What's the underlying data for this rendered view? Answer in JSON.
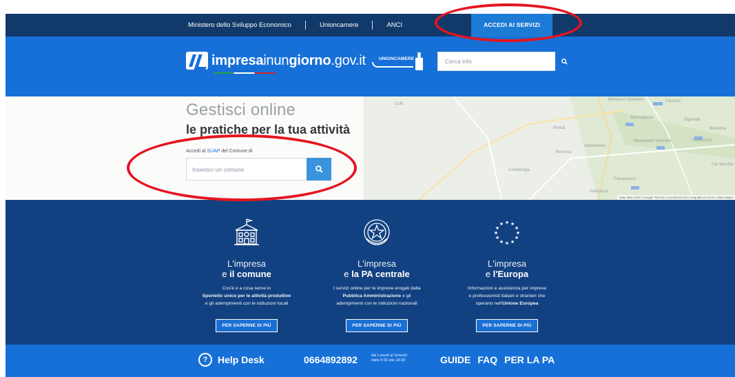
{
  "topbar": {
    "links": [
      "Ministero dello Sviluppo Economico",
      "Unioncamere",
      "ANCI"
    ],
    "cta": "ACCEDI AI SERVIZI"
  },
  "header": {
    "logo_bold1": "impresa",
    "logo_light1": "inun",
    "logo_bold2": "giorno",
    "logo_light2": ".gov.it",
    "partner_logo": "UNIONCAMERE",
    "search_placeholder": "Cerca info"
  },
  "hero": {
    "title_line1": "Gestisci online",
    "title_line2": "le pratiche per la tua attività",
    "label_prefix": "Accedi al ",
    "label_link": "SUAP",
    "label_suffix": " del Comune di",
    "search_placeholder": "Inserisci un comune",
    "map_copyright": "Map data ©2017 Google   Termini e condizioni d'uso   Segnala un errore nella mappa",
    "map_places": [
      "Montorso Vicentino",
      "Paulona",
      "Zermeghedo",
      "Signaldo",
      "Brendola",
      "Pedocchio",
      "Montebello Vicentino",
      "Gambellara",
      "Roncà",
      "Sarmazza",
      "Fracanzana",
      "Cal Vecchia",
      "Colli",
      "Costalunga",
      "Terrossa"
    ]
  },
  "services": [
    {
      "icon": "town-hall-icon",
      "lead": "L'impresa",
      "head_prefix": "e ",
      "head_bold": "il comune",
      "desc1": "Cos'è e a cosa serve lo",
      "desc2_bold": "Sportello unico per le attività produttive",
      "desc3": "e gli adempimenti con le istituzioni locali",
      "cta": "PER SAPERNE DI PIÙ"
    },
    {
      "icon": "italian-emblem-icon",
      "lead": "L'impresa",
      "head_prefix": "e ",
      "head_bold": "la PA centrale",
      "desc1": "I servizi online per le imprese erogati dalla",
      "desc2_bold": "Pubblica Amministrazione",
      "desc2_rest": " e gli",
      "desc3": "adempimenti con le istituzioni nazionali",
      "cta": "PER SAPERNE DI PIÙ"
    },
    {
      "icon": "eu-stars-icon",
      "lead": "L'impresa",
      "head_prefix": "e ",
      "head_bold": "l'Europa",
      "desc1": "Informazioni e assistenza per imprese",
      "desc2": "e professionisti italiani e stranieri che",
      "desc3_prefix": "operano nell'",
      "desc3_bold": "Unione Europea",
      "cta": "PER SAPERNE DI PIÙ"
    }
  ],
  "footerbar": {
    "helpdesk_icon": "?",
    "helpdesk_label": "Help Desk",
    "phone": "0664892892",
    "hours_line1": "dal Lunedì al Venerdì",
    "hours_line2": "dalle 8:30 alle 18:30",
    "links": [
      "GUIDE",
      "FAQ",
      "PER LA PA"
    ]
  },
  "colors": {
    "topbar": "#113a6b",
    "header": "#1770d8",
    "services": "#124181",
    "annotation": "#e4151f"
  }
}
